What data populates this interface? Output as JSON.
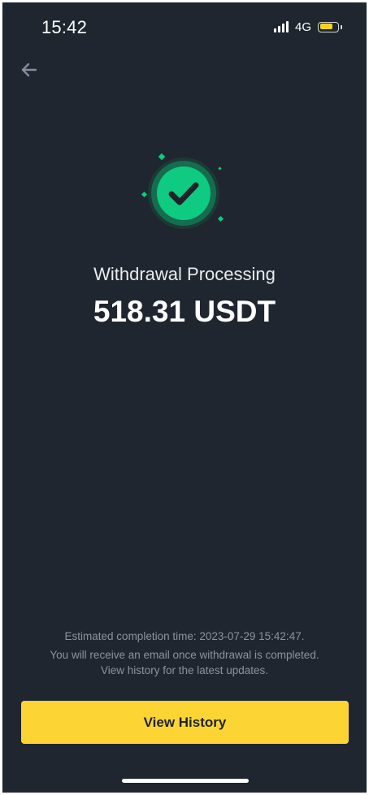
{
  "status_bar": {
    "time": "15:42",
    "network": "4G",
    "battery_level": 0.75
  },
  "nav": {
    "back_icon": "arrow-left-icon"
  },
  "status": {
    "icon": "check-circle-icon",
    "title": "Withdrawal Processing",
    "amount": "518.31 USDT"
  },
  "info": {
    "estimated": "Estimated completion time: 2023-07-29 15:42:47.",
    "email_notice": "You will receive an email once withdrawal is completed.",
    "history_notice": "View history for the latest updates."
  },
  "actions": {
    "view_history_label": "View History"
  },
  "colors": {
    "background": "#1f2630",
    "accent": "#fcd535",
    "success": "#0ecb81"
  }
}
